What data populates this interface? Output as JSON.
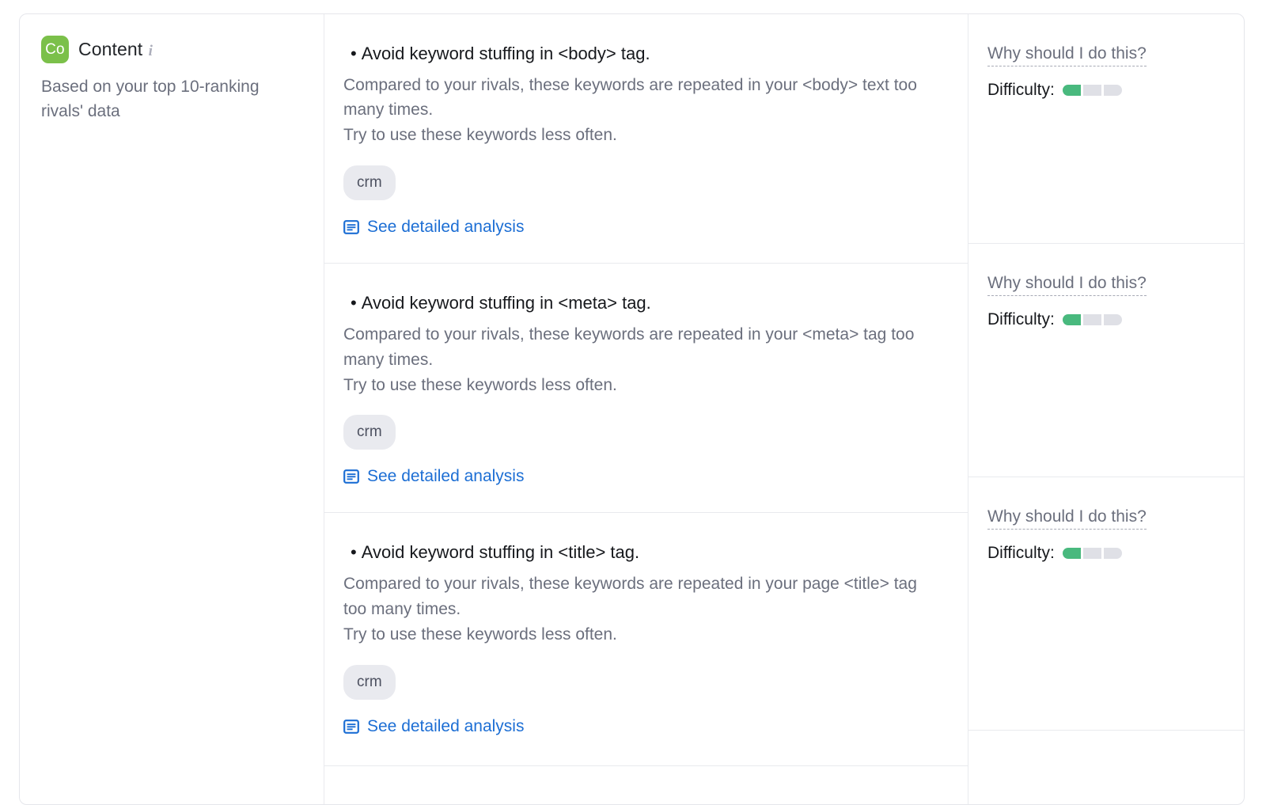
{
  "category": {
    "badge_text": "Co",
    "badge_color": "#7bc04a",
    "title": "Content",
    "info_icon": "info-icon",
    "subtitle": "Based on your top 10-ranking rivals' data"
  },
  "labels": {
    "why_link": "Why should I do this?",
    "difficulty_label": "Difficulty:",
    "analysis_link": "See detailed analysis",
    "bullet": "•"
  },
  "colors": {
    "link": "#1c6ed4",
    "difficulty_on": "#49b97e",
    "difficulty_off": "#dfe0e6",
    "chip_bg": "#e9eaef",
    "border": "#e9eaee"
  },
  "issues": [
    {
      "title": "Avoid keyword stuffing in <body> tag.",
      "desc_line1": "Compared to your rivals, these keywords are repeated in your <body> text too many times.",
      "desc_line2": "Try to use these keywords less often.",
      "keywords": [
        "crm"
      ],
      "analysis_link": "See detailed analysis",
      "why_link": "Why should I do this?",
      "difficulty_label": "Difficulty:",
      "difficulty_level": 1,
      "difficulty_max": 3
    },
    {
      "title": "Avoid keyword stuffing in <meta> tag.",
      "desc_line1": "Compared to your rivals, these keywords are repeated in your <meta> tag too many times.",
      "desc_line2": "Try to use these keywords less often.",
      "keywords": [
        "crm"
      ],
      "analysis_link": "See detailed analysis",
      "why_link": "Why should I do this?",
      "difficulty_label": "Difficulty:",
      "difficulty_level": 1,
      "difficulty_max": 3
    },
    {
      "title": "Avoid keyword stuffing in <title> tag.",
      "desc_line1": "Compared to your rivals, these keywords are repeated in your page <title> tag too many times.",
      "desc_line2": "Try to use these keywords less often.",
      "keywords": [
        "crm"
      ],
      "analysis_link": "See detailed analysis",
      "why_link": "Why should I do this?",
      "difficulty_label": "Difficulty:",
      "difficulty_level": 1,
      "difficulty_max": 3
    }
  ]
}
